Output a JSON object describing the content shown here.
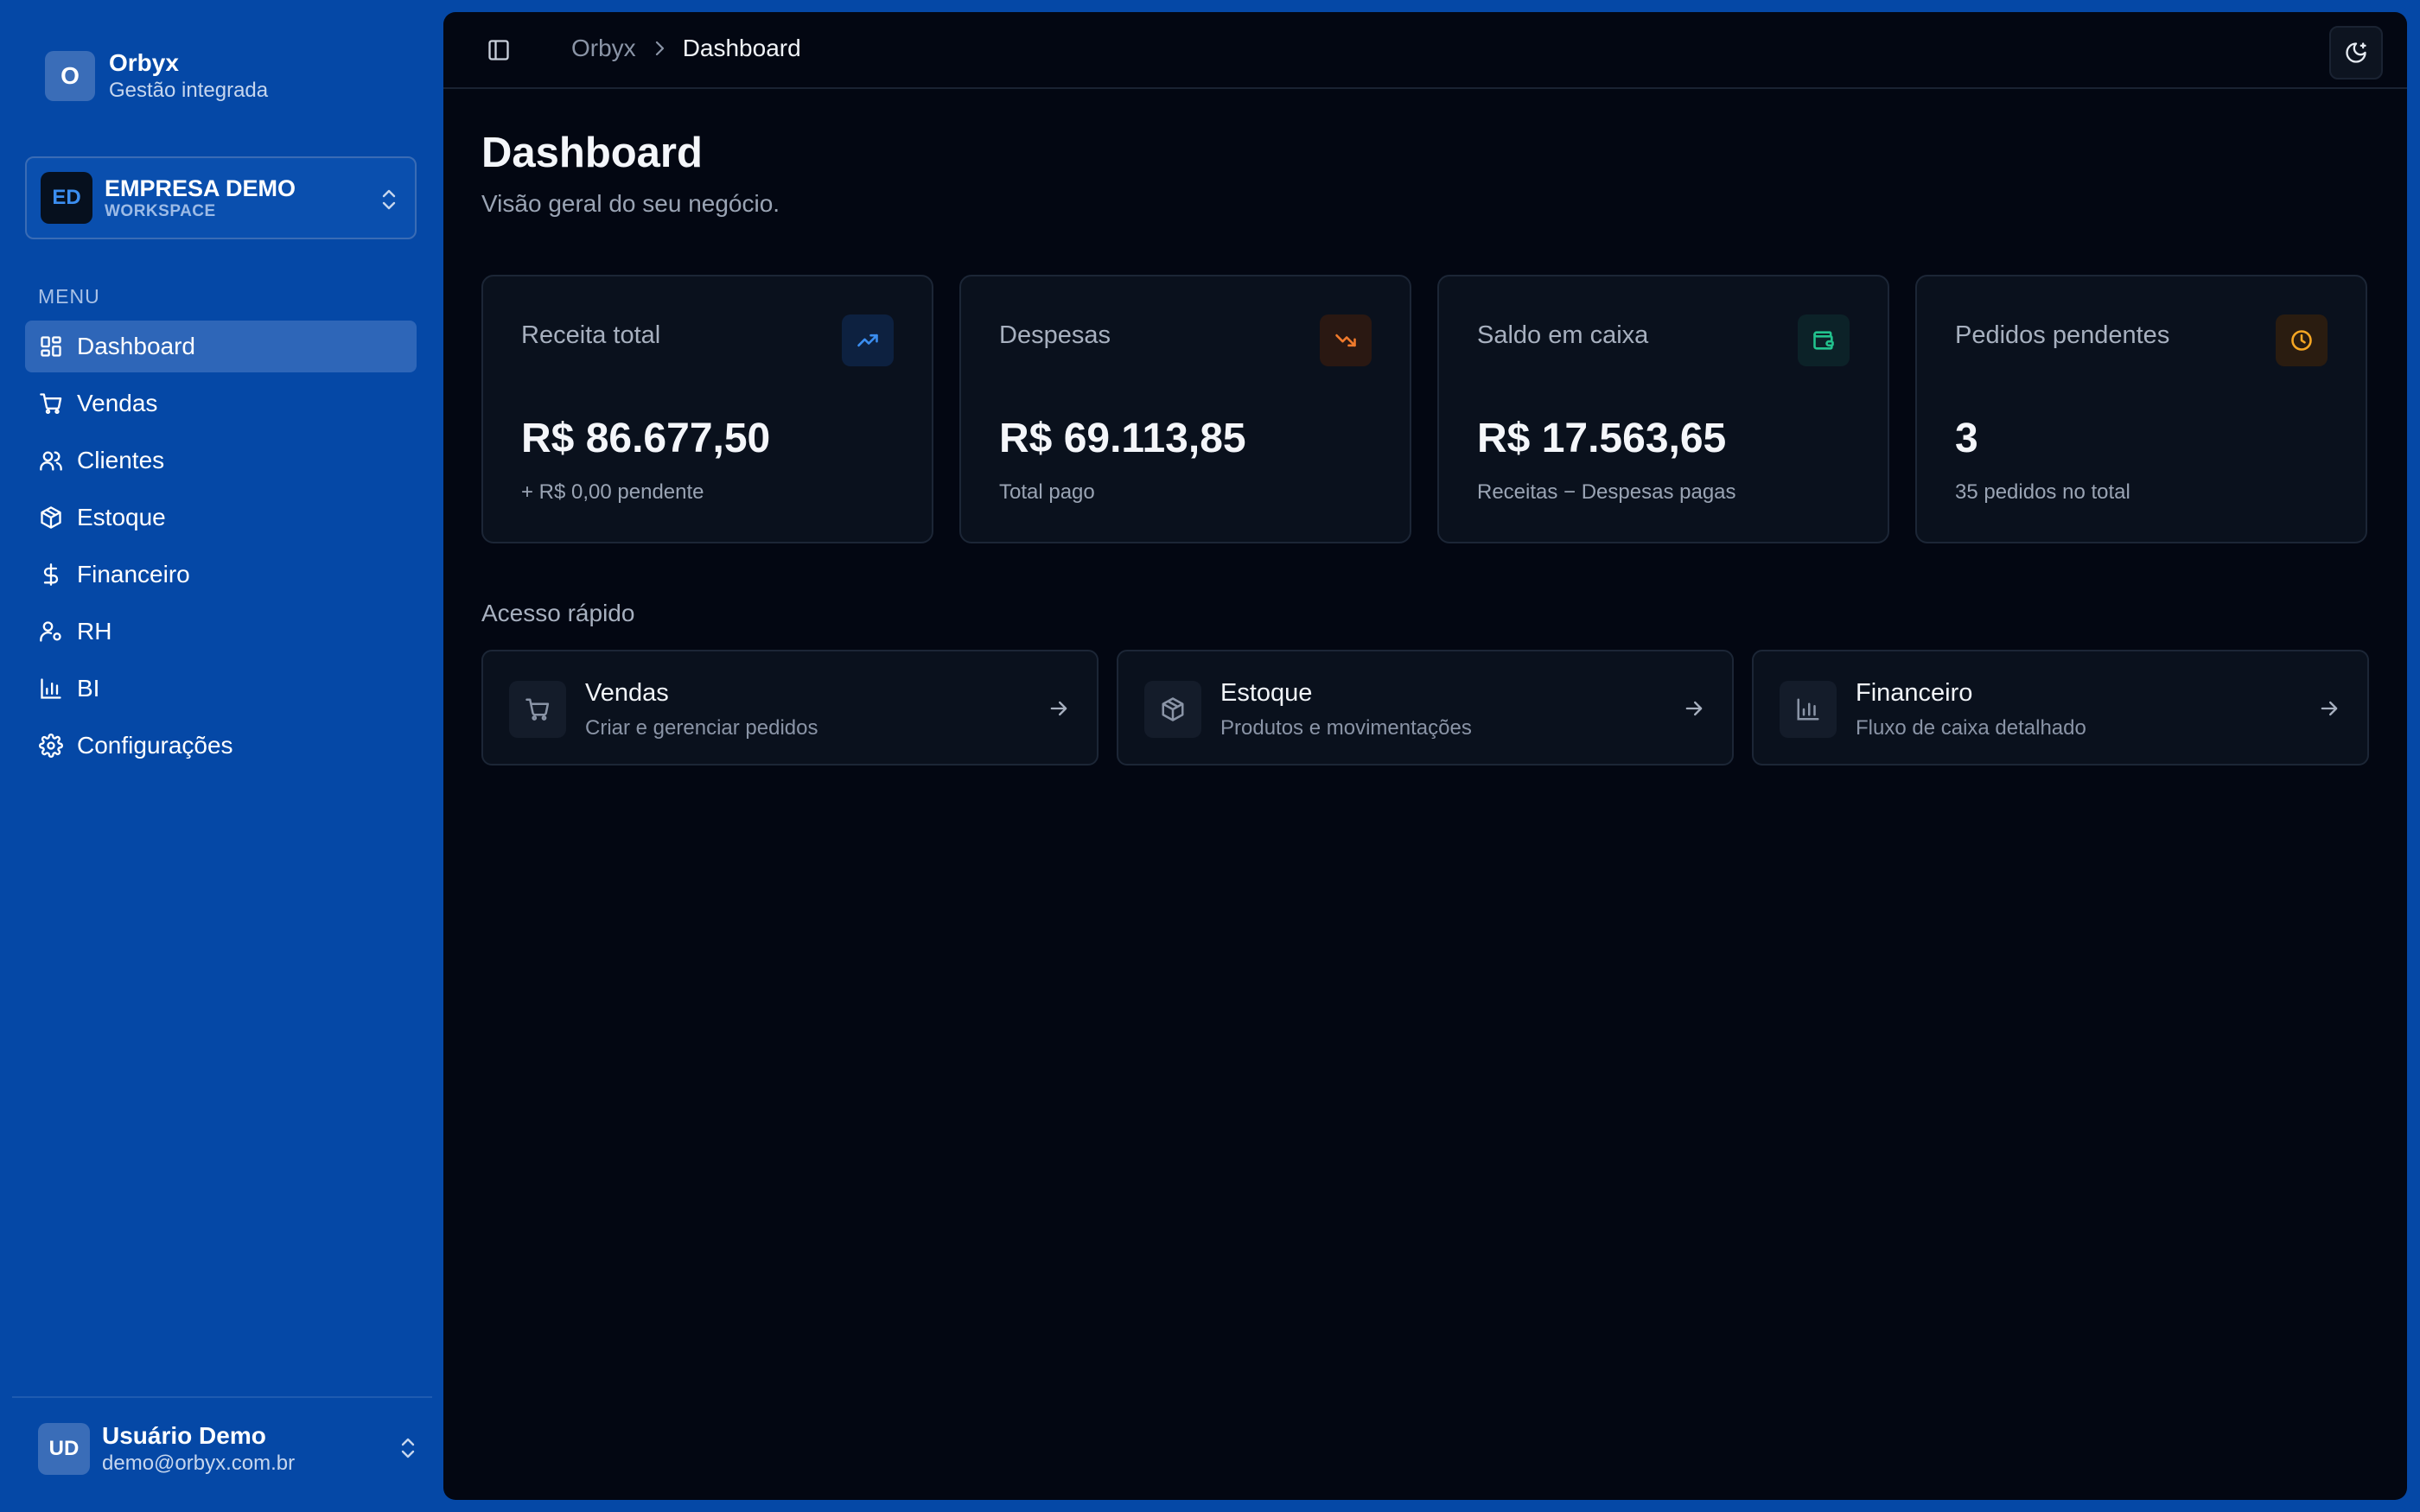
{
  "sidebar": {
    "brand": {
      "logo": "O",
      "name": "Orbyx",
      "subtitle": "Gestão integrada"
    },
    "workspace": {
      "initials": "ED",
      "name": "EMPRESA DEMO",
      "tag": "WORKSPACE",
      "icon": "chevrons-up-down-icon"
    },
    "menu_label": "MENU",
    "items": [
      {
        "label": "Dashboard",
        "icon": "dashboard-icon",
        "active": true
      },
      {
        "label": "Vendas",
        "icon": "cart-icon"
      },
      {
        "label": "Clientes",
        "icon": "users-icon"
      },
      {
        "label": "Estoque",
        "icon": "package-icon"
      },
      {
        "label": "Financeiro",
        "icon": "dollar-icon"
      },
      {
        "label": "RH",
        "icon": "user-cog-icon"
      },
      {
        "label": "BI",
        "icon": "bar-chart-icon"
      },
      {
        "label": "Configurações",
        "icon": "settings-icon"
      }
    ],
    "user": {
      "initials": "UD",
      "name": "Usuário Demo",
      "email": "demo@orbyx.com.br"
    }
  },
  "header": {
    "breadcrumb": [
      "Orbyx",
      "Dashboard"
    ],
    "icons": {
      "toggle": "sidebar-toggle-icon",
      "theme": "moon-icon"
    }
  },
  "page": {
    "title": "Dashboard",
    "subtitle": "Visão geral do seu negócio."
  },
  "stats": [
    {
      "label": "Receita total",
      "value": "R$ 86.677,50",
      "note": "+ R$ 0,00 pendente",
      "icon": "trending-up-icon",
      "color": "#3b8ef0"
    },
    {
      "label": "Despesas",
      "value": "R$ 69.113,85",
      "note": "Total pago",
      "icon": "trending-down-icon",
      "color": "#f07a2c"
    },
    {
      "label": "Saldo em caixa",
      "value": "R$ 17.563,65",
      "note": "Receitas − Despesas pagas",
      "icon": "wallet-icon",
      "color": "#22c38e"
    },
    {
      "label": "Pedidos pendentes",
      "value": "3",
      "note": "35 pedidos no total",
      "icon": "clock-icon",
      "color": "#f5a623"
    }
  ],
  "quick_access": {
    "label": "Acesso rápido",
    "items": [
      {
        "title": "Vendas",
        "subtitle": "Criar e gerenciar pedidos",
        "icon": "cart-icon"
      },
      {
        "title": "Estoque",
        "subtitle": "Produtos e movimentações",
        "icon": "package-icon"
      },
      {
        "title": "Financeiro",
        "subtitle": "Fluxo de caixa detalhado",
        "icon": "bar-chart-icon"
      }
    ]
  }
}
